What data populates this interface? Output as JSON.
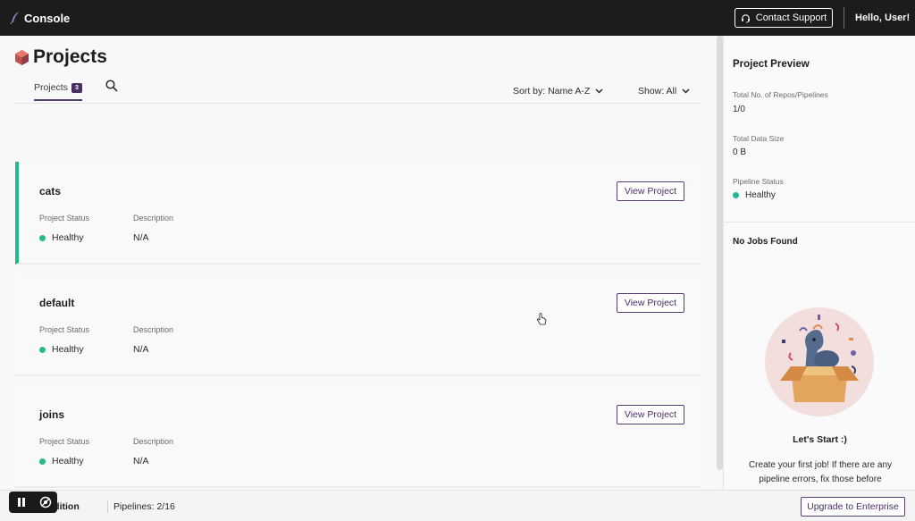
{
  "topbar": {
    "brand_label": "Console",
    "support_label": "Contact Support",
    "greeting": "Hello, User!"
  },
  "header": {
    "title": "Projects"
  },
  "tabs": {
    "projects_label": "Projects",
    "projects_count": "3"
  },
  "controls": {
    "sort_label": "Sort by: Name A-Z",
    "show_label": "Show: All"
  },
  "projects": [
    {
      "name": "cats",
      "status_label": "Project Status",
      "status": "Healthy",
      "description_label": "Description",
      "description": "N/A",
      "view_label": "View  Project",
      "selected": true
    },
    {
      "name": "default",
      "status_label": "Project Status",
      "status": "Healthy",
      "description_label": "Description",
      "description": "N/A",
      "view_label": "View  Project",
      "selected": false
    },
    {
      "name": "joins",
      "status_label": "Project Status",
      "status": "Healthy",
      "description_label": "Description",
      "description": "N/A",
      "view_label": "View  Project",
      "selected": false
    }
  ],
  "preview": {
    "title": "Project Preview",
    "repos_label": "Total No. of Repos/Pipelines",
    "repos_value": "1/0",
    "size_label": "Total Data Size",
    "size_value": "0 B",
    "pipeline_status_label": "Pipeline Status",
    "pipeline_status_value": "Healthy",
    "no_jobs": "No Jobs Found",
    "lets_start": "Let's Start :)",
    "create_text": "Create your first job! If there are any pipeline errors, fix those before"
  },
  "footer": {
    "edition": "ity Edition",
    "pipelines": "Pipelines: 2/16",
    "upgrade_label": "Upgrade to Enterprise"
  },
  "colors": {
    "accent": "#4b2d66",
    "healthy": "#27b88c",
    "topbar": "#1c1c1c"
  }
}
